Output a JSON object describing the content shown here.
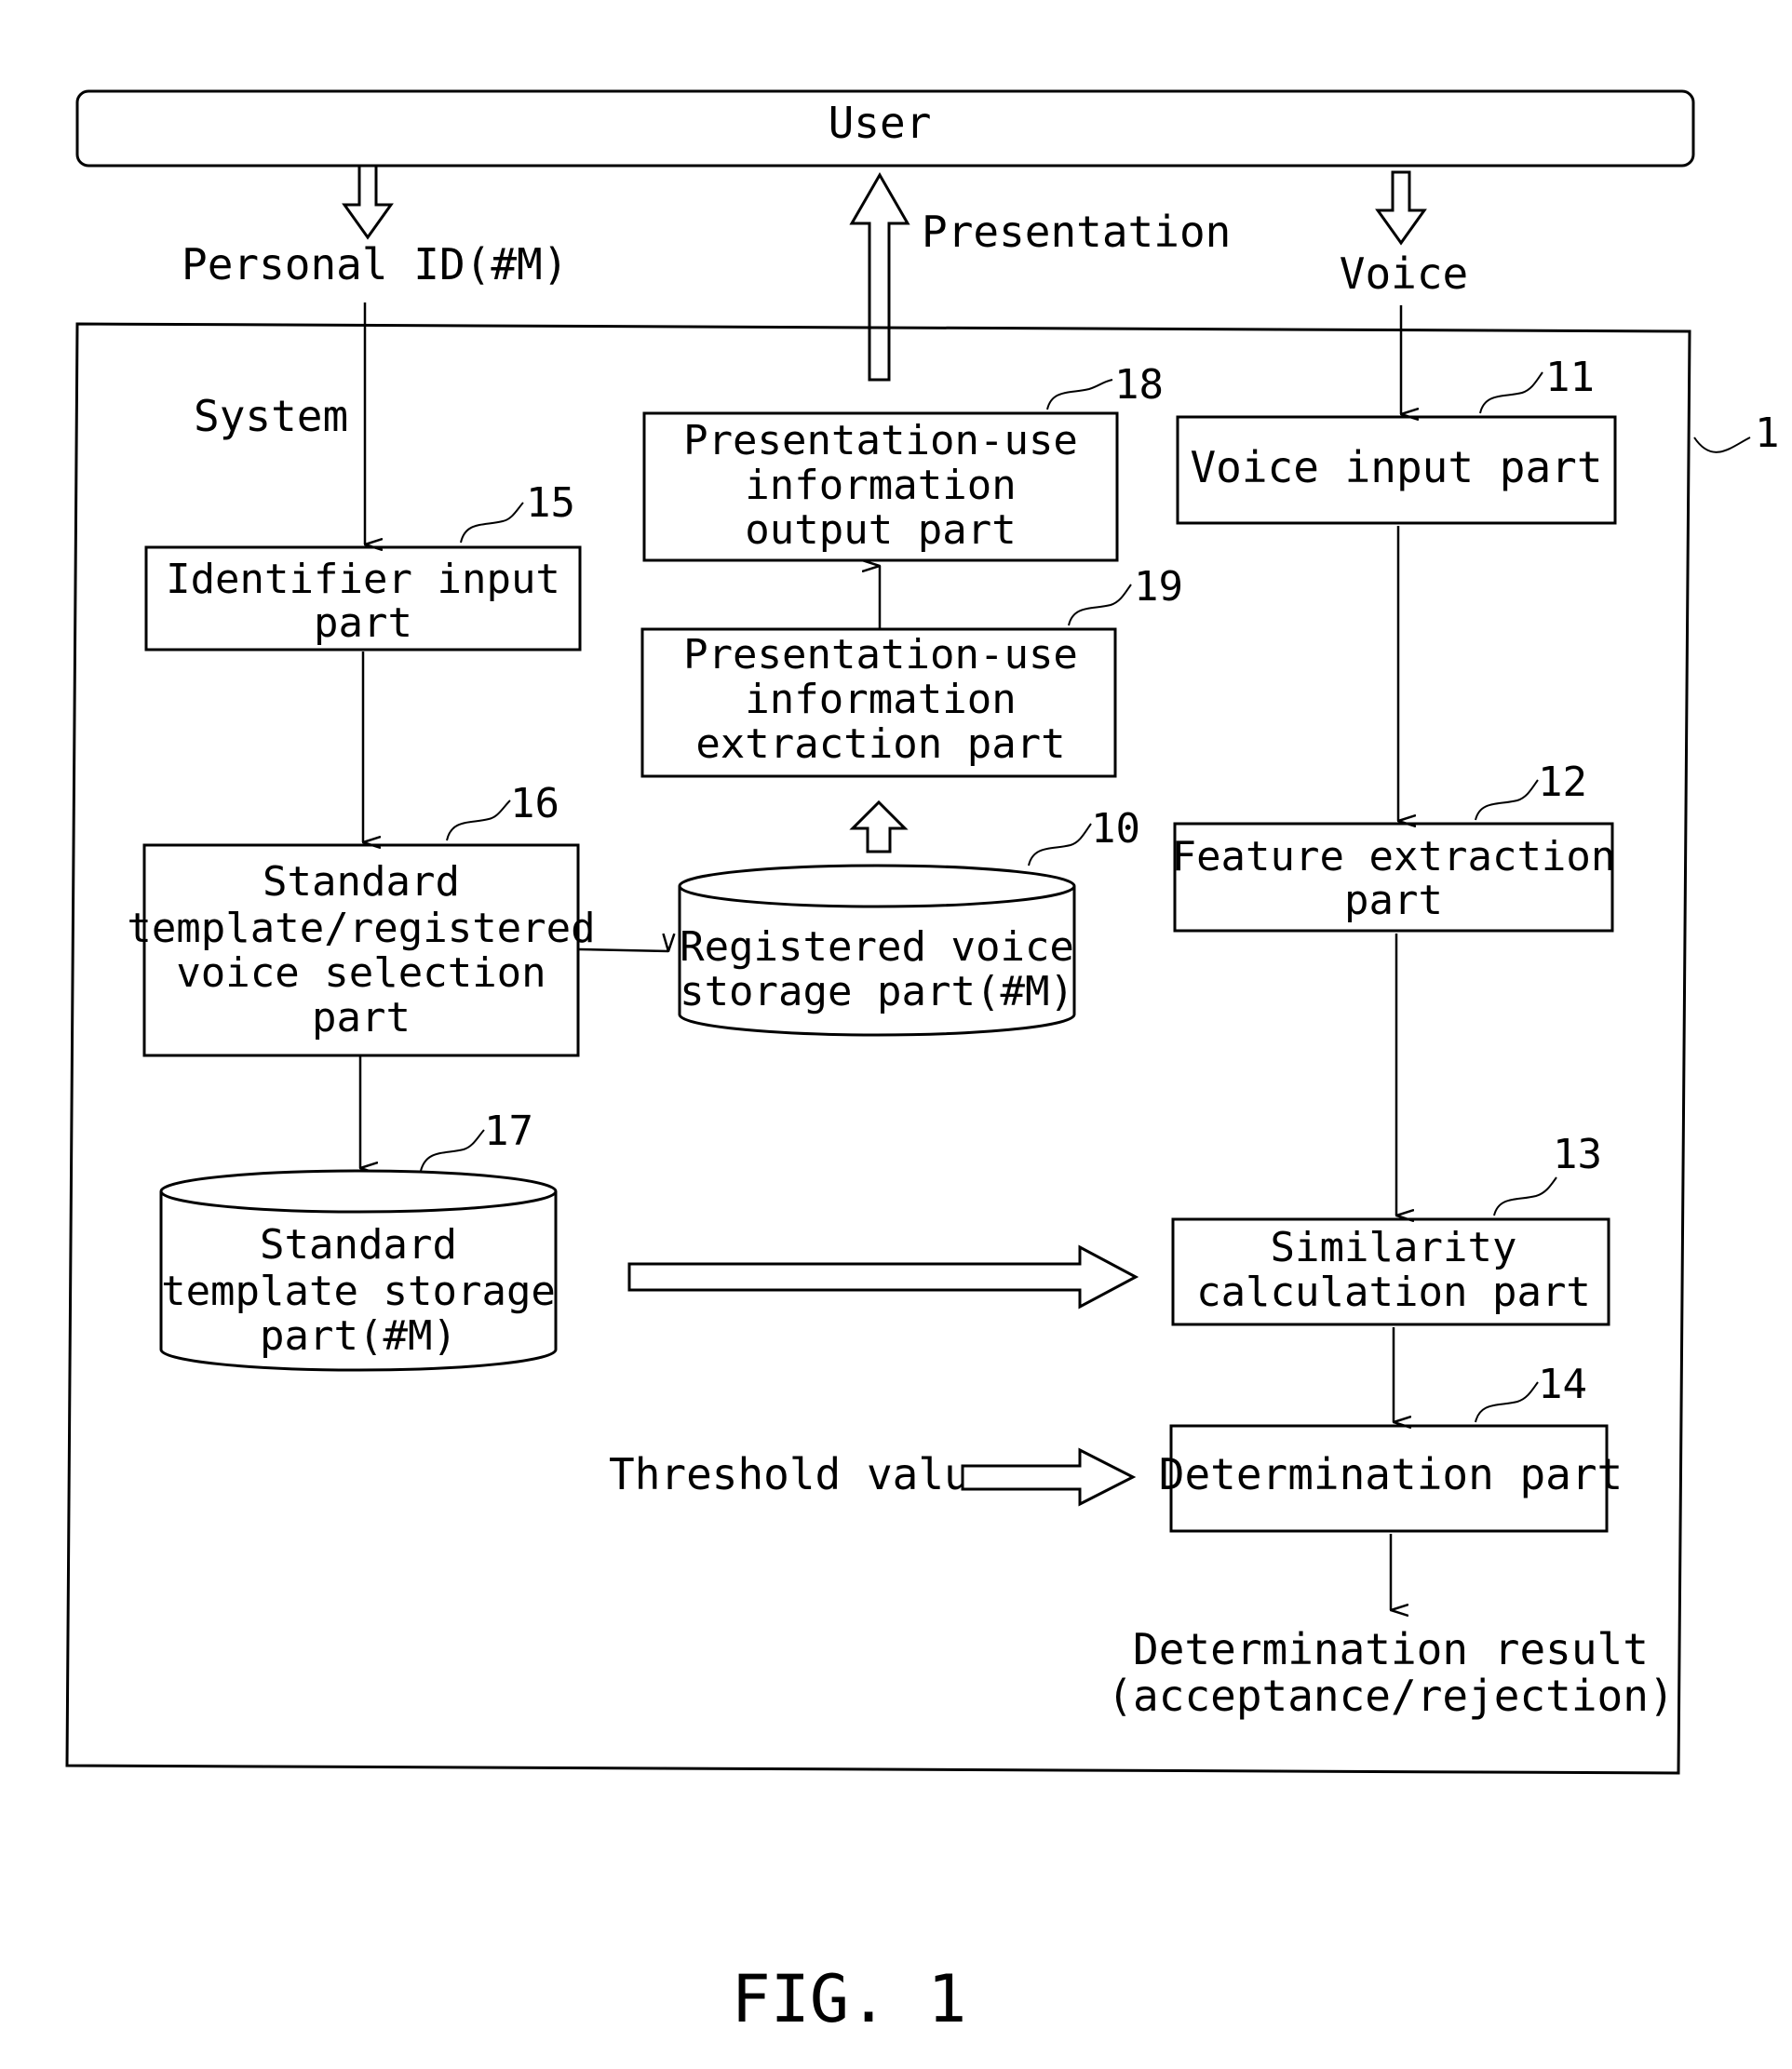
{
  "user_bar": {
    "label": "User"
  },
  "flows": {
    "personal_id": "Personal ID(#M)",
    "presentation": "Presentation",
    "voice": "Voice",
    "system": "System",
    "threshold": "Threshold value",
    "result_line1": "Determination result",
    "result_line2": "(acceptance/rejection)"
  },
  "system_ref": "1",
  "blocks": {
    "b11": {
      "ref": "11",
      "lines": [
        "Voice input part"
      ]
    },
    "b12": {
      "ref": "12",
      "lines": [
        "Feature extraction",
        "part"
      ]
    },
    "b13": {
      "ref": "13",
      "lines": [
        "Similarity",
        "calculation part"
      ]
    },
    "b14": {
      "ref": "14",
      "lines": [
        "Determination part"
      ]
    },
    "b15": {
      "ref": "15",
      "lines": [
        "Identifier input",
        "part"
      ]
    },
    "b16": {
      "ref": "16",
      "lines": [
        "Standard",
        "template/registered",
        "voice selection",
        "part"
      ]
    },
    "b18": {
      "ref": "18",
      "lines": [
        "Presentation-use",
        "information",
        "output part"
      ]
    },
    "b19": {
      "ref": "19",
      "lines": [
        "Presentation-use",
        "information",
        "extraction part"
      ]
    },
    "db10": {
      "ref": "10",
      "lines": [
        "Registered voice",
        "storage part(#M)"
      ]
    },
    "db17": {
      "ref": "17",
      "lines": [
        "Standard",
        "template storage",
        "part(#M)"
      ]
    }
  },
  "figure_caption": "FIG. 1"
}
